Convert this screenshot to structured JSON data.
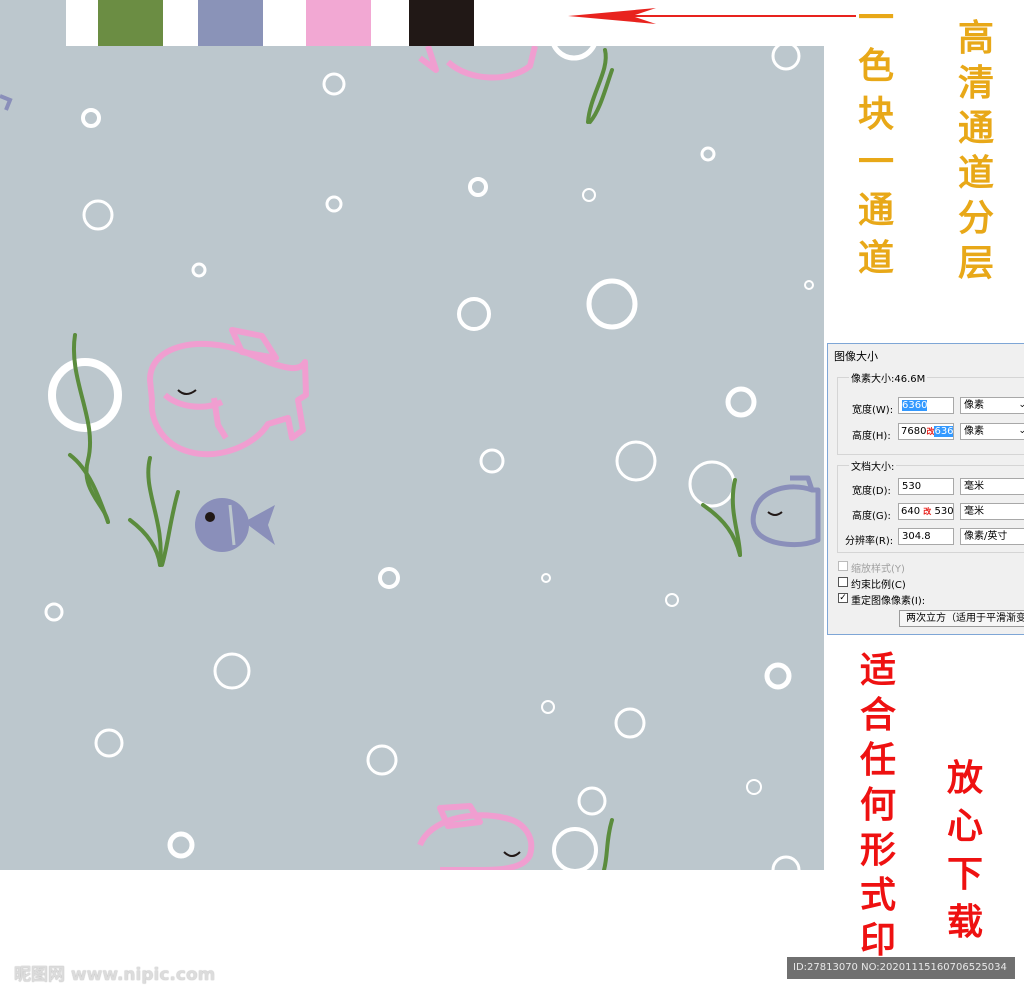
{
  "colors": {
    "background": "#bcc7cd",
    "swatches": [
      "#6b8d43",
      "#8a93b8",
      "#f2a8d3",
      "#211816"
    ],
    "pink_fish": "#f09ed0",
    "blue_fish": "#8a8fba",
    "seaweed": "#5b8c3d",
    "bubble": "#ffffff",
    "gold_text": "#e8a818",
    "red_text": "#ee1111"
  },
  "text": {
    "left_gold": [
      "一",
      "色",
      "块",
      "一",
      "通",
      "道"
    ],
    "right_gold": [
      "高",
      "清",
      "通",
      "道",
      "分",
      "层"
    ],
    "red_a": [
      "适",
      "合",
      "任",
      "何",
      "形",
      "式",
      "印"
    ],
    "red_b": [
      "放",
      "心",
      "下",
      "载"
    ]
  },
  "dialog": {
    "title": "图像大小",
    "pixel_size": "像素大小:46.6M",
    "width_label": "宽度(W):",
    "width_value": "6360",
    "width_unit": "像素",
    "height_label": "高度(H):",
    "height_old": "7680",
    "height_mark": "改",
    "height_new": "6360",
    "height_unit": "像素",
    "doc_size": "文档大小:",
    "doc_width_label": "宽度(D):",
    "doc_width_value": "530",
    "doc_width_unit": "毫米",
    "doc_height_label": "高度(G):",
    "doc_height_old": "640",
    "doc_height_mark": "改",
    "doc_height_new": "530",
    "doc_height_unit": "毫米",
    "resolution_label": "分辨率(R):",
    "resolution_value": "304.8",
    "resolution_unit": "像素/英寸",
    "scale_styles": "缩放样式(Y)",
    "constrain": "约束比例(C)",
    "resample": "重定图像像素(I):",
    "resample_method": "两次立方（适用于平滑渐变"
  },
  "watermark": "昵图网 www.nipic.com",
  "id_bar": "ID:27813070 NO:20201115160706525034"
}
